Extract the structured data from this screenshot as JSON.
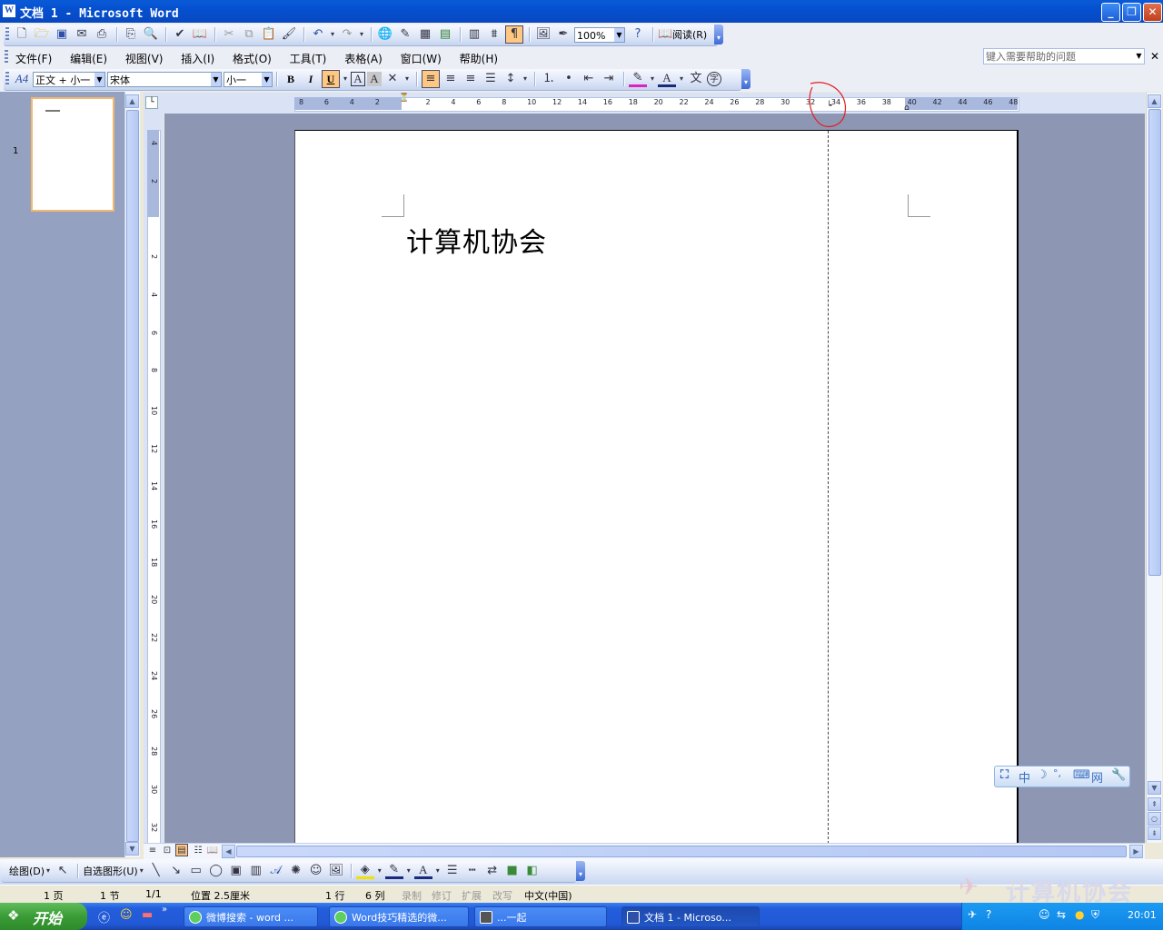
{
  "window": {
    "title": "文档 1 - Microsoft Word",
    "app_icon": "W"
  },
  "help_box": {
    "placeholder": "键入需要帮助的问题"
  },
  "standard_toolbar": {
    "zoom": "100%",
    "read_label": "阅读(R)"
  },
  "menu": [
    "文件(F)",
    "编辑(E)",
    "视图(V)",
    "插入(I)",
    "格式(O)",
    "工具(T)",
    "表格(A)",
    "窗口(W)",
    "帮助(H)"
  ],
  "formatting_toolbar": {
    "style": "正文 + 小一",
    "font": "宋体",
    "size": "小一",
    "bold": "B",
    "italic": "I",
    "underline": "U"
  },
  "ruler": {
    "h_numbers": [
      "8",
      "6",
      "4",
      "2",
      "",
      "2",
      "4",
      "6",
      "8",
      "10",
      "12",
      "14",
      "16",
      "18",
      "20",
      "22",
      "24",
      "26",
      "28",
      "30",
      "32",
      "34",
      "36",
      "38",
      "40",
      "42",
      "44",
      "46",
      "48"
    ],
    "v_numbers": [
      "4",
      "2",
      "",
      "2",
      "4",
      "6",
      "8",
      "10",
      "12",
      "14",
      "16",
      "18",
      "20",
      "22",
      "24",
      "26",
      "28",
      "30",
      "32"
    ]
  },
  "thumbnail": {
    "page_number": "1"
  },
  "document": {
    "text": "计算机协会"
  },
  "draw_toolbar": {
    "draw_label": "绘图(D)",
    "autoshape_label": "自选图形(U)"
  },
  "status": {
    "page": "1 页",
    "section": "1 节",
    "pages": "1/1",
    "position": "位置 2.5厘米",
    "line": "1 行",
    "col": "6 列",
    "rec": "录制",
    "trk": "修订",
    "ext": "扩展",
    "ovr": "改写",
    "lang": "中文(中国)"
  },
  "taskbar": {
    "start": "开始",
    "tasks": [
      "微博搜索 - word ...",
      "Word技巧精选的微...",
      "...一起",
      "文档 1 - Microso..."
    ],
    "clock": "20:01"
  },
  "ime": {
    "label": "中"
  },
  "watermark": "计算机协会",
  "colors": {
    "title_bar": "#0550D0",
    "annotation_circle": "#E02020",
    "page": "#FFFFFF",
    "workspace": "#8D97B4"
  }
}
